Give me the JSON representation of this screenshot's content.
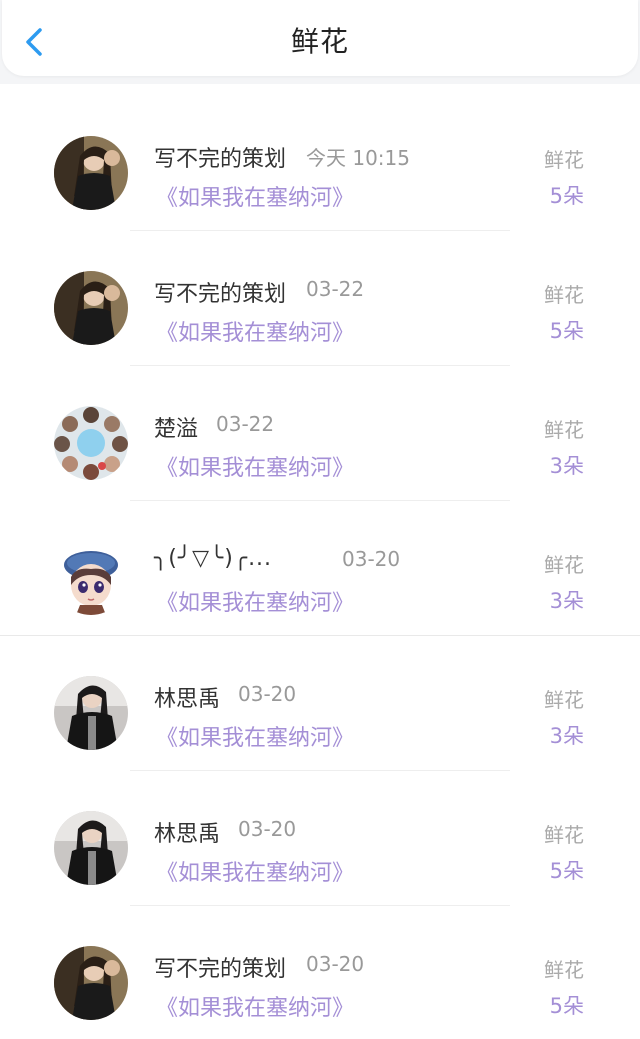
{
  "header": {
    "title": "鲜花",
    "back_icon": "chevron-left-icon",
    "accent": "#2d9bf0"
  },
  "colors": {
    "book_title": "#a48fd6",
    "muted": "#999999"
  },
  "records": [
    {
      "name": "写不完的策划",
      "time": "今天 10:15",
      "book": "《如果我在塞纳河》",
      "gift_label": "鲜花",
      "gift_count": "5朵",
      "avatar": "avatar-dark-hair"
    },
    {
      "name": "写不完的策划",
      "time": "03-22",
      "book": "《如果我在塞纳河》",
      "gift_label": "鲜花",
      "gift_count": "5朵",
      "avatar": "avatar-dark-hair"
    },
    {
      "name": "楚溢",
      "time": "03-22",
      "book": "《如果我在塞纳河》",
      "gift_label": "鲜花",
      "gift_count": "3朵",
      "avatar": "avatar-collage"
    },
    {
      "name": "╮(╯▽╰)╭...",
      "time": "03-20",
      "book": "《如果我在塞纳河》",
      "gift_label": "鲜花",
      "gift_count": "3朵",
      "avatar": "avatar-cartoon-beret"
    },
    {
      "name": "林思禹",
      "time": "03-20",
      "book": "《如果我在塞纳河》",
      "gift_label": "鲜花",
      "gift_count": "3朵",
      "avatar": "avatar-black-jacket"
    },
    {
      "name": "林思禹",
      "time": "03-20",
      "book": "《如果我在塞纳河》",
      "gift_label": "鲜花",
      "gift_count": "5朵",
      "avatar": "avatar-black-jacket"
    },
    {
      "name": "写不完的策划",
      "time": "03-20",
      "book": "《如果我在塞纳河》",
      "gift_label": "鲜花",
      "gift_count": "5朵",
      "avatar": "avatar-dark-hair"
    }
  ]
}
